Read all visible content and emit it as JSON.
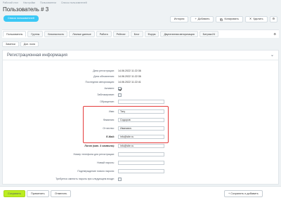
{
  "breadcrumbs": [
    "Рабочий стол",
    "Настройки",
    "Пользователи",
    "Список пользователей"
  ],
  "title": "Пользователь # 3",
  "back_button": "Список пользователей",
  "actions": {
    "history": "История",
    "add": "Добавить",
    "copy": "Копировать",
    "delete": "Удалить"
  },
  "tabs": [
    "Пользователь",
    "Группы",
    "Безопасность",
    "Личные данные",
    "Работа",
    "Рейтинг",
    "Блог",
    "Форум",
    "Двухэтапная авторизация",
    "Битрикс24"
  ],
  "subtabs": [
    "Заметки",
    "Доп. поля"
  ],
  "section_title": "Регистрационная информация",
  "info": {
    "reg_date_label": "Дата регистрации:",
    "reg_date": "14.06.2022 11:22:36",
    "upd_date_label": "Дата обновления:",
    "upd_date": "14.06.2022 11:22:36",
    "last_auth_label": "Последняя авторизация:",
    "last_auth": "14.06.2022 11:22:41",
    "active_label": "Активен:",
    "blocked_label": "Заблокирован:"
  },
  "fields": {
    "salutation_label": "Обращение:",
    "salutation": "",
    "name_label": "Имя:",
    "name": "Тагу",
    "lastname_label": "Фамилия:",
    "lastname": "Сидоров",
    "patronymic_label": "Отчество:",
    "patronymic": "Иванович",
    "email_label": "E-Mail:",
    "email": "info@site.ru",
    "login_label": "Логин (мин. 3 символа):",
    "login": "info@site.ru",
    "phone_label": "Номер телефона для регистрации:",
    "phone": "",
    "newpass_label": "Новый пароль:",
    "newpass": "",
    "confirm_label": "Подтверждение нового пароля:",
    "confirm": "",
    "require_change_label": "Требуется сменить пароль при следующем входе:",
    "site_label": "Внешний сэ:"
  },
  "bottom": {
    "save": "Сохранить",
    "apply": "Применить",
    "cancel": "Отменить",
    "save_add": "Сохранить и добавить"
  },
  "colors": {
    "accent": "#3bc8f5",
    "highlight": "#e53b3b",
    "save": "#bbed21"
  }
}
